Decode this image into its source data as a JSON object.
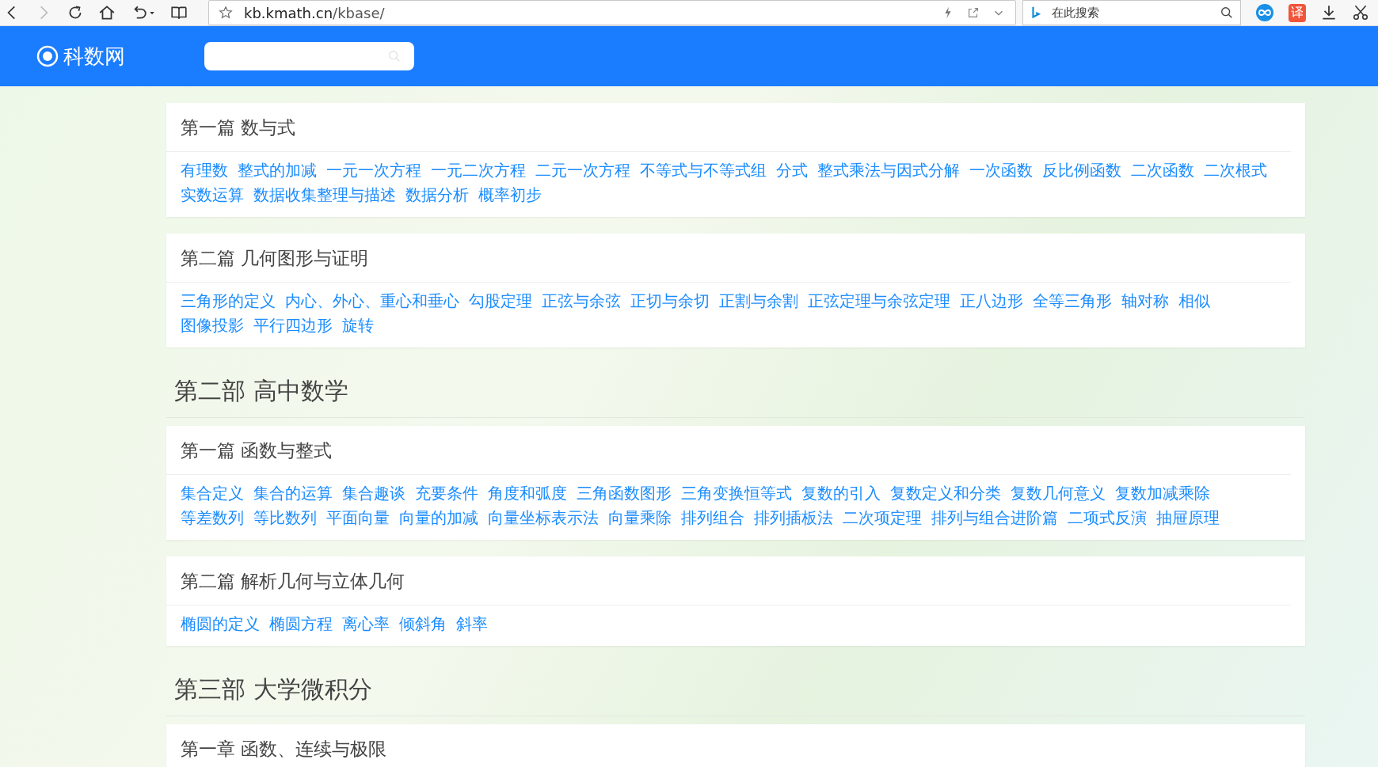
{
  "browser": {
    "url_host": "kb.kmath.cn",
    "url_path": "/kbase/",
    "search_placeholder": "在此搜索",
    "translate_label": "译"
  },
  "site": {
    "logo": "科数网"
  },
  "sections": [
    {
      "kind": "card",
      "title": "第一篇 数与式",
      "links": [
        "有理数",
        "整式的加减",
        "一元一次方程",
        "一元二次方程",
        "二元一次方程",
        "不等式与不等式组",
        "分式",
        "整式乘法与因式分解",
        "一次函数",
        "反比例函数",
        "二次函数",
        "二次根式",
        "实数运算",
        "数据收集整理与描述",
        "数据分析",
        "概率初步"
      ]
    },
    {
      "kind": "card",
      "title": "第二篇 几何图形与证明",
      "links": [
        "三角形的定义",
        "内心、外心、重心和垂心",
        "勾股定理",
        "正弦与余弦",
        "正切与余切",
        "正割与余割",
        "正弦定理与余弦定理",
        "正八边形",
        "全等三角形",
        "轴对称",
        "相似",
        "图像投影",
        "平行四边形",
        "旋转"
      ]
    },
    {
      "kind": "part",
      "title": "第二部 高中数学"
    },
    {
      "kind": "card",
      "title": "第一篇 函数与整式",
      "links": [
        "集合定义",
        "集合的运算",
        "集合趣谈",
        "充要条件",
        "角度和弧度",
        "三角函数图形",
        "三角变换恒等式",
        "复数的引入",
        "复数定义和分类",
        "复数几何意义",
        "复数加减乘除",
        "等差数列",
        "等比数列",
        "平面向量",
        "向量的加减",
        "向量坐标表示法",
        "向量乘除",
        "排列组合",
        "排列插板法",
        "二次项定理",
        "排列与组合进阶篇",
        "二项式反演",
        "抽屉原理"
      ]
    },
    {
      "kind": "card",
      "title": "第二篇 解析几何与立体几何",
      "links": [
        "椭圆的定义",
        "椭圆方程",
        "离心率",
        "倾斜角",
        "斜率"
      ]
    },
    {
      "kind": "part",
      "title": "第三部 大学微积分"
    },
    {
      "kind": "card",
      "title": "第一章 函数、连续与极限"
    }
  ]
}
